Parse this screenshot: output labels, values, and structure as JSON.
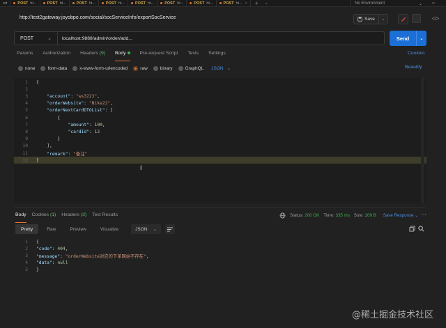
{
  "tabs": [
    {
      "method": "",
      "label": "ort",
      "dot": false
    },
    {
      "method": "POST",
      "label": "ht...",
      "dot": true
    },
    {
      "method": "POST",
      "label": "ht...",
      "dot": true
    },
    {
      "method": "POST",
      "label": "ht...",
      "dot": true
    },
    {
      "method": "POST",
      "label": "ht...",
      "dot": true
    },
    {
      "method": "POST",
      "label": "ht...",
      "dot": true
    },
    {
      "method": "POST",
      "label": "ht...",
      "dot": true
    },
    {
      "method": "POST",
      "label": "ht...",
      "dot": true
    },
    {
      "method": "POST",
      "label": "ht...",
      "dot": true
    }
  ],
  "environment": {
    "label": "No Environment"
  },
  "request": {
    "title": "http://test2gateway.joyobpo.com/social/socServiceInfo/exportSocService",
    "method": "POST",
    "url": "localhost:9888/admin/order/add...",
    "save_label": "Save",
    "send_label": "Send"
  },
  "request_tabs": [
    {
      "label": "Params",
      "count": ""
    },
    {
      "label": "Authorization",
      "count": ""
    },
    {
      "label": "Headers",
      "count": "(9)"
    },
    {
      "label": "Body",
      "count": ""
    },
    {
      "label": "Pre-request Script",
      "count": ""
    },
    {
      "label": "Tests",
      "count": ""
    },
    {
      "label": "Settings",
      "count": ""
    }
  ],
  "cookies_label": "Cookies",
  "body_types": [
    "none",
    "form-data",
    "x-www-form-urlencoded",
    "raw",
    "binary",
    "GraphQL"
  ],
  "body_language": "JSON",
  "beautify_label": "Beautify",
  "request_body": [
    {
      "n": "1",
      "text": "{"
    },
    {
      "n": "2",
      "text": ""
    },
    {
      "n": "3",
      "key": "\"account\"",
      "val": "\"ws3223\"",
      "vt": "s",
      "tail": ",",
      "indent": 4
    },
    {
      "n": "4",
      "key": "\"orderWebsite\"",
      "val": "\"Nike22\"",
      "vt": "s",
      "tail": ",",
      "indent": 4
    },
    {
      "n": "5",
      "key": "\"orderNextCardDTOList\"",
      "val": "[",
      "vt": "p",
      "tail": "",
      "indent": 4
    },
    {
      "n": "6",
      "text": "{",
      "indent": 8
    },
    {
      "n": "7",
      "key": "\"amount\"",
      "val": "100",
      "vt": "n",
      "tail": ",",
      "indent": 12
    },
    {
      "n": "8",
      "key": "\"cardId\"",
      "val": "12",
      "vt": "n",
      "tail": "",
      "indent": 12
    },
    {
      "n": "9",
      "text": "}",
      "indent": 8
    },
    {
      "n": "10",
      "text": "],",
      "indent": 4
    },
    {
      "n": "11",
      "key": "\"remark\"",
      "val": "\"备注\"",
      "vt": "s",
      "tail": "",
      "indent": 4
    },
    {
      "n": "12",
      "text": "}"
    }
  ],
  "response_tabs": [
    {
      "label": "Body",
      "count": ""
    },
    {
      "label": "Cookies",
      "count": "(1)"
    },
    {
      "label": "Headers",
      "count": "(3)"
    },
    {
      "label": "Test Results",
      "count": ""
    }
  ],
  "response_stats": {
    "status_label": "Status:",
    "status_value": "200 OK",
    "time_label": "Time:",
    "time_value": "335 ms",
    "size_label": "Size:",
    "size_value": "209 B",
    "save_label": "Save Response"
  },
  "response_views": [
    "Pretty",
    "Raw",
    "Preview",
    "Visualize"
  ],
  "response_format": "JSON",
  "response_body": [
    {
      "n": "1",
      "text": "{"
    },
    {
      "n": "2",
      "key": "\"code\"",
      "val": "404",
      "vt": "n",
      "tail": ","
    },
    {
      "n": "3",
      "key": "\"message\"",
      "val": "\"orderWebsite对应的下单网站不存在\"",
      "vt": "s",
      "tail": ","
    },
    {
      "n": "4",
      "key": "\"data\"",
      "val": "null",
      "vt": "n",
      "tail": ""
    },
    {
      "n": "5",
      "text": "}"
    }
  ],
  "watermark": "@稀土掘金技术社区"
}
